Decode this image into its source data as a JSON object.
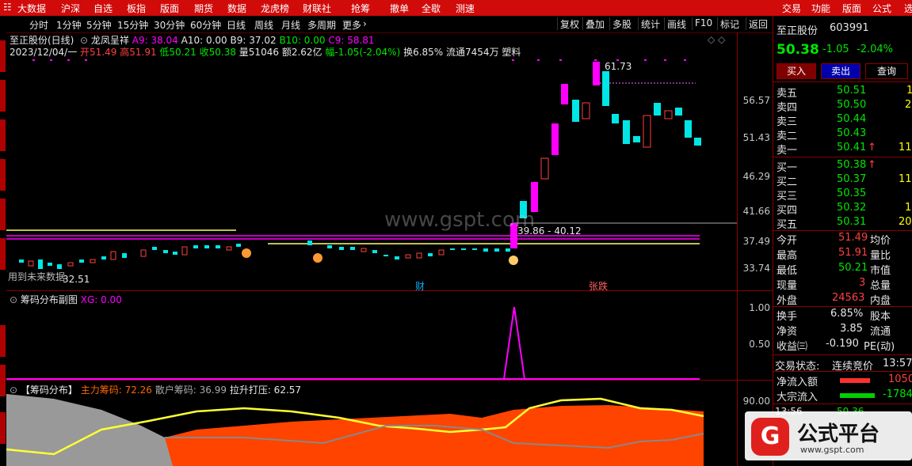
{
  "menubar": {
    "items": [
      "大数据",
      "沪深",
      "自选",
      "板指",
      "版面",
      "期货",
      "数据",
      "龙虎榜",
      "财联社",
      "抢筹",
      "撤单",
      "全歇",
      "测速"
    ],
    "right_items": [
      "交易",
      "功能",
      "版面",
      "公式",
      "选"
    ]
  },
  "periods": [
    "分时",
    "1分钟",
    "5分钟",
    "15分钟",
    "30分钟",
    "60分钟",
    "日线",
    "周线",
    "月线",
    "多周期",
    "更多"
  ],
  "toolbar": [
    "复权",
    "叠加",
    "多股",
    "统计",
    "画线",
    "F10",
    "标记",
    "返回"
  ],
  "main_panel": {
    "title": "至正股份(日线)",
    "indicator_name": "龙凤呈祥",
    "indicators": [
      {
        "label": "A9: 38.04",
        "color": "#ff00ff"
      },
      {
        "label": "A10: 0.00",
        "color": "#e6e6e6"
      },
      {
        "label": "B9: 37.02",
        "color": "#e6e6e6"
      },
      {
        "label": "B10: 0.00",
        "color": "#00e600"
      },
      {
        "label": "C9: 58.81",
        "color": "#ff00ff"
      }
    ],
    "ohlc": {
      "date": "2023/12/04/一",
      "open": "开51.49",
      "high": "高51.91",
      "low": "低50.21",
      "close": "收50.38",
      "volume": "量51046",
      "amount": "额2.62亿",
      "change": "幅-1.05(-2.04%)",
      "turnover": "换6.85%",
      "float": "流通7454万",
      "industry": "塑料"
    },
    "yaxis": [
      "56.57",
      "51.43",
      "46.29",
      "41.66",
      "37.49",
      "33.74"
    ],
    "annotations": {
      "high_label": "61.73",
      "range_label": "39.86 - 40.12",
      "low_label": "32.51",
      "watermark": "www.gspt.com",
      "cai": "财",
      "zhangdie": "张跌",
      "left_text": "用到未来数据"
    }
  },
  "sub_panel1": {
    "title": "筹码分布副图",
    "xg": "XG: 0.00",
    "yaxis": [
      "1.00",
      "0.50"
    ]
  },
  "sub_panel2": {
    "title": "【筹码分布】",
    "main_chip": "主力筹码: 72.26",
    "retail_chip": "散户筹码: 36.99",
    "pull_up": "拉升打压: 62.57",
    "yaxis": [
      "90.00"
    ]
  },
  "quote": {
    "name": "至正股份",
    "code": "603991",
    "price": "50.38",
    "change": "-1.05",
    "pct": "-2.04%",
    "buy_btn": "买入",
    "sell_btn": "卖出",
    "query_btn": "查询",
    "asks": [
      {
        "label": "卖五",
        "price": "50.51",
        "vol": "1"
      },
      {
        "label": "卖四",
        "price": "50.50",
        "vol": "2"
      },
      {
        "label": "卖三",
        "price": "50.44",
        "vol": ""
      },
      {
        "label": "卖二",
        "price": "50.43",
        "vol": ""
      },
      {
        "label": "卖一",
        "price": "50.41",
        "vol": "11"
      }
    ],
    "bids": [
      {
        "label": "买一",
        "price": "50.38",
        "vol": ""
      },
      {
        "label": "买二",
        "price": "50.37",
        "vol": "11"
      },
      {
        "label": "买三",
        "price": "50.35",
        "vol": ""
      },
      {
        "label": "买四",
        "price": "50.32",
        "vol": "1"
      },
      {
        "label": "买五",
        "price": "50.31",
        "vol": "20"
      }
    ],
    "stats": [
      {
        "l1": "今开",
        "v1": "51.49",
        "l2": "均价"
      },
      {
        "l1": "最高",
        "v1": "51.91",
        "l2": "量比"
      },
      {
        "l1": "最低",
        "v1": "50.21",
        "l2": "市值"
      },
      {
        "l1": "现量",
        "v1": "3",
        "l2": "总量"
      },
      {
        "l1": "外盘",
        "v1": "24563",
        "l2": "内盘"
      }
    ],
    "stats2": [
      {
        "l1": "换手",
        "v1": "6.85%",
        "l2": "股本"
      },
      {
        "l1": "净资",
        "v1": "3.85",
        "l2": "流通"
      },
      {
        "l1": "收益㈢",
        "v1": "-0.190",
        "l2": "PE(动)"
      }
    ],
    "trade_state_label": "交易状态:",
    "trade_state": "连续竞价",
    "trade_time": "13:57",
    "net_inflow_label": "净流入额",
    "net_inflow": "1050",
    "block_inflow_label": "大宗流入",
    "block_inflow": "-1784",
    "tick_time": "13:56",
    "tick_price": "50.36"
  },
  "logo": {
    "text": "公式平台",
    "url": "www.gspt.com"
  },
  "colors": {
    "up": "#ff4040",
    "down": "#00e6e6",
    "magenta": "#ff00ff",
    "accent": "#d10a0a"
  }
}
